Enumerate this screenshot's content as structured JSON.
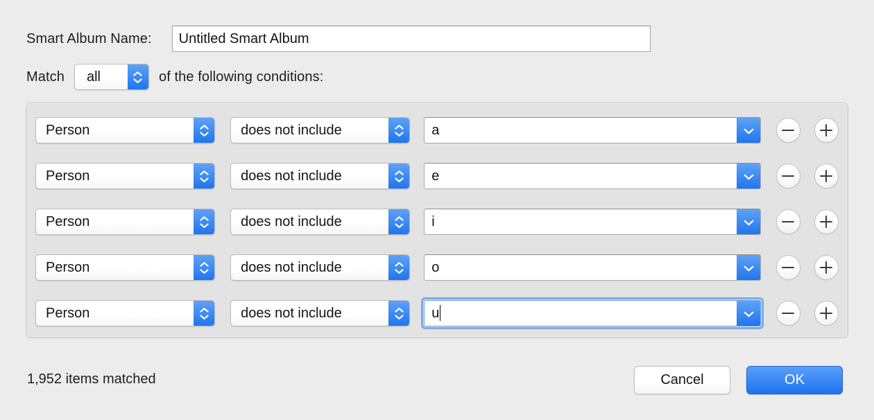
{
  "dialog": {
    "name_label": "Smart Album Name:",
    "album_name": "Untitled Smart Album",
    "album_name_placeholder": "Untitled Smart Album",
    "match_label": "Match",
    "match_value": "all",
    "match_trailing_label": "of the following conditions:",
    "status": "1,952 items matched",
    "cancel_label": "Cancel",
    "ok_label": "OK",
    "accent_color": "#1f76ef",
    "focus_ring_color": "#7aa9e8",
    "window_background": "#ececec",
    "panel_background": "#e3e3e3"
  },
  "conditions": [
    {
      "field": "Person",
      "operator": "does not include",
      "value": "a",
      "focused": false,
      "remove_label": "remove-condition",
      "add_label": "add-condition"
    },
    {
      "field": "Person",
      "operator": "does not include",
      "value": "e",
      "focused": false,
      "remove_label": "remove-condition",
      "add_label": "add-condition"
    },
    {
      "field": "Person",
      "operator": "does not include",
      "value": "i",
      "focused": false,
      "remove_label": "remove-condition",
      "add_label": "add-condition"
    },
    {
      "field": "Person",
      "operator": "does not include",
      "value": "o",
      "focused": false,
      "remove_label": "remove-condition",
      "add_label": "add-condition"
    },
    {
      "field": "Person",
      "operator": "does not include",
      "value": "u",
      "focused": true,
      "remove_label": "remove-condition",
      "add_label": "add-condition"
    }
  ],
  "icons": {
    "stepper": "stepper-up-down-icon",
    "combo_chevron": "chevron-down-icon",
    "minus": "minus-icon",
    "plus": "plus-icon"
  }
}
